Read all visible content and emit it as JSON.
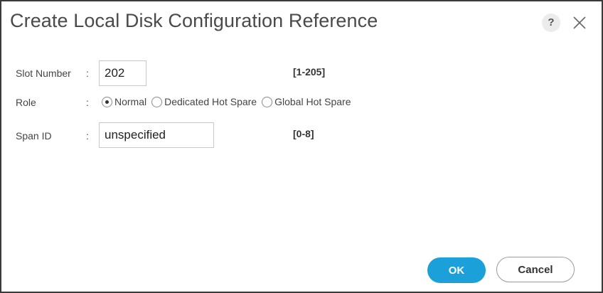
{
  "dialog": {
    "title": "Create Local Disk Configuration Reference",
    "help_label": "?"
  },
  "form": {
    "slot_number": {
      "label": "Slot Number",
      "colon": ":",
      "value": "202",
      "hint": "[1-205]"
    },
    "role": {
      "label": "Role",
      "colon": ":",
      "options": [
        {
          "label": "Normal",
          "selected": true
        },
        {
          "label": "Dedicated Hot Spare",
          "selected": false
        },
        {
          "label": "Global Hot Spare",
          "selected": false
        }
      ]
    },
    "span_id": {
      "label": "Span ID",
      "colon": ":",
      "value": "unspecified",
      "hint": "[0-8]"
    }
  },
  "buttons": {
    "ok": "OK",
    "cancel": "Cancel"
  },
  "colors": {
    "accent": "#1ba0d9",
    "border": "#3a3a3a"
  }
}
